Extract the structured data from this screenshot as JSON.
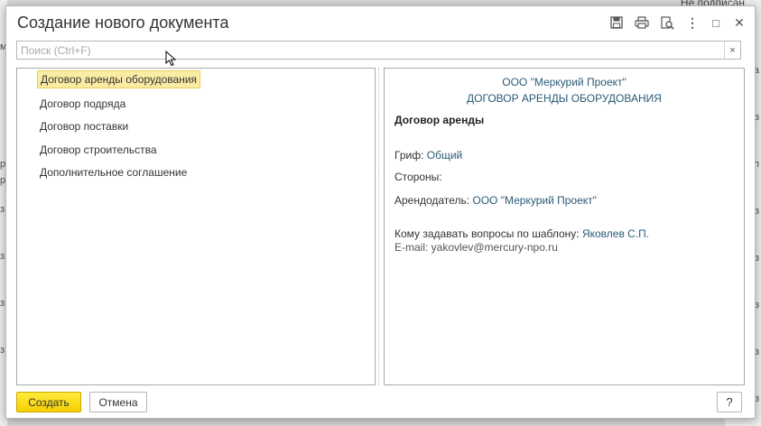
{
  "background": {
    "top_right_text": "Не подписан",
    "left_glyphs": [
      "м",
      "р",
      "р",
      "з",
      "з",
      "з",
      "з"
    ],
    "right_glyphs": [
      "а",
      "з",
      "л",
      "з",
      "з",
      "з",
      "з",
      "з"
    ]
  },
  "dialog": {
    "title": "Создание нового документа",
    "toolbar": {
      "save_icon": "save-icon",
      "print_icon": "print-icon",
      "preview_icon": "print-preview-icon",
      "more_label": "⋮",
      "maximize_label": "□",
      "close_label": "✕"
    },
    "search": {
      "placeholder": "Поиск (Ctrl+F)",
      "value": "",
      "clear_label": "×"
    },
    "templates": [
      "Договор аренды оборудования",
      "Договор подряда",
      "Договор поставки",
      "Договор строительства",
      "Дополнительное соглашение"
    ],
    "selected_index": 0,
    "preview": {
      "company": "ООО \"Меркурий Проект\"",
      "doc_title": "ДОГОВОР АРЕНДЫ ОБОРУДОВАНИЯ",
      "heading": "Договор аренды",
      "grif_label": "Гриф:",
      "grif_value": "Общий",
      "parties_label": "Стороны:",
      "lessor_label": "Арендодатель:",
      "lessor_value": "ООО \"Меркурий Проект\"",
      "contact_label": "Кому задавать вопросы по шаблону:",
      "contact_value": "Яковлев С.П.",
      "email_line": "E-mail: yakovlev@mercury-npo.ru"
    },
    "buttons": {
      "create": "Создать",
      "cancel": "Отмена",
      "help": "?"
    }
  }
}
